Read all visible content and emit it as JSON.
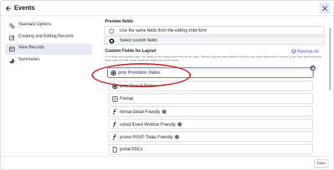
{
  "window": {
    "title": "Events"
  },
  "sidebar": {
    "items": [
      {
        "label": "Standard Options",
        "icon": "tune-icon",
        "active": false
      },
      {
        "label": "Creating and Editing Records",
        "icon": "edit-record-icon",
        "active": false
      },
      {
        "label": "View Records",
        "icon": "view-records-icon",
        "active": true
      },
      {
        "label": "Summaries",
        "icon": "summaries-icon",
        "active": false
      }
    ]
  },
  "main": {
    "preview_section_title": "Preview fields",
    "option_same": "Use the same fields from the editing child form",
    "option_custom": "Select custom fields",
    "option_custom_selected": true,
    "custom_title": "Custom Fields for Layout",
    "remove_all_label": "Remove All",
    "help_text": "If no fields are provided here, the fields of the editing child form will be used. Different layouts have different limits to how many fields will be shown. If you have selected more fields than the limit, those additional fields will not be shown.",
    "fields": [
      {
        "label": "proc Promotion Status",
        "icon": "radio-icon",
        "help": false,
        "highlighted": true
      },
      {
        "label": "proc Overall Status",
        "icon": "radio-icon",
        "help": false,
        "highlighted": false
      },
      {
        "label": "Format",
        "icon": "checklist-icon",
        "help": false,
        "highlighted": false
      },
      {
        "label": "format Detail Friendly",
        "icon": "formula-icon",
        "help": true,
        "highlighted": false
      },
      {
        "label": "sched Event Window Friendly",
        "icon": "formula-icon",
        "help": true,
        "highlighted": false
      },
      {
        "label": "promo RSVP Totals Friendly",
        "icon": "formula-icon",
        "help": true,
        "highlighted": false
      },
      {
        "label": "portal PDCs",
        "icon": "document-icon",
        "help": false,
        "highlighted": false
      }
    ]
  },
  "footer": {
    "done_label": "Done"
  },
  "colors": {
    "accent": "#4f46e5",
    "highlight_border": "#5b5fd9",
    "annotation_red": "#c0282e"
  }
}
